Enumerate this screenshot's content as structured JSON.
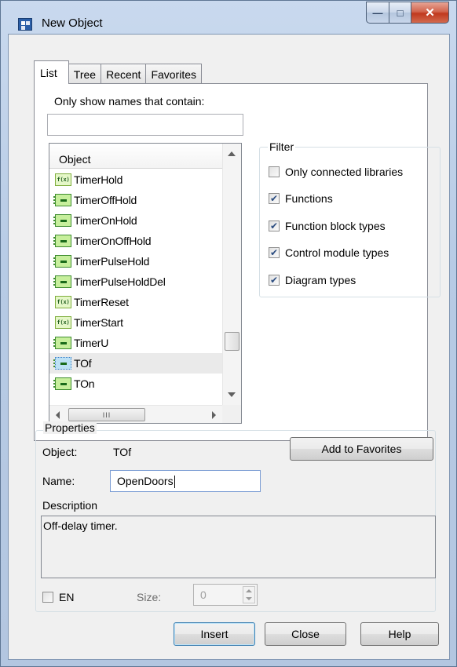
{
  "window": {
    "title": "New Object"
  },
  "tabs": [
    {
      "label": "List",
      "active": true
    },
    {
      "label": "Tree",
      "active": false
    },
    {
      "label": "Recent",
      "active": false
    },
    {
      "label": "Favorites",
      "active": false
    }
  ],
  "search": {
    "label": "Only show names that contain:",
    "value": ""
  },
  "object_list": {
    "header": "Object",
    "items": [
      {
        "name": "TimerHold",
        "icon": "function-icon"
      },
      {
        "name": "TimerOffHold",
        "icon": "function-block-icon"
      },
      {
        "name": "TimerOnHold",
        "icon": "function-block-icon"
      },
      {
        "name": "TimerOnOffHold",
        "icon": "function-block-icon"
      },
      {
        "name": "TimerPulseHold",
        "icon": "function-block-icon"
      },
      {
        "name": "TimerPulseHoldDel",
        "icon": "function-block-icon"
      },
      {
        "name": "TimerReset",
        "icon": "function-icon"
      },
      {
        "name": "TimerStart",
        "icon": "function-icon"
      },
      {
        "name": "TimerU",
        "icon": "function-block-icon"
      },
      {
        "name": "TOf",
        "icon": "function-block-icon",
        "selected": true
      },
      {
        "name": "TOn",
        "icon": "function-block-icon"
      }
    ],
    "hscroll_grip": "III"
  },
  "filter": {
    "legend": "Filter",
    "options": [
      {
        "label": "Only connected libraries",
        "checked": false
      },
      {
        "label": "Functions",
        "checked": true
      },
      {
        "label": "Function block types",
        "checked": true
      },
      {
        "label": "Control module types",
        "checked": true
      },
      {
        "label": "Diagram types",
        "checked": true
      }
    ]
  },
  "properties": {
    "legend": "Properties",
    "object_label": "Object:",
    "object_value": "TOf",
    "add_favorites_label": "Add to Favorites",
    "name_label": "Name:",
    "name_value": "OpenDoors",
    "description_label": "Description",
    "description_value": "Off-delay timer.",
    "en_label": "EN",
    "en_checked": false,
    "size_label": "Size:",
    "size_value": "0"
  },
  "buttons": {
    "insert": "Insert",
    "close": "Close",
    "help": "Help"
  },
  "colors": {
    "frame": "#b7cbe5",
    "client": "#f0f0f0",
    "close_button": "#c0391e",
    "check": "#2b4c80"
  }
}
